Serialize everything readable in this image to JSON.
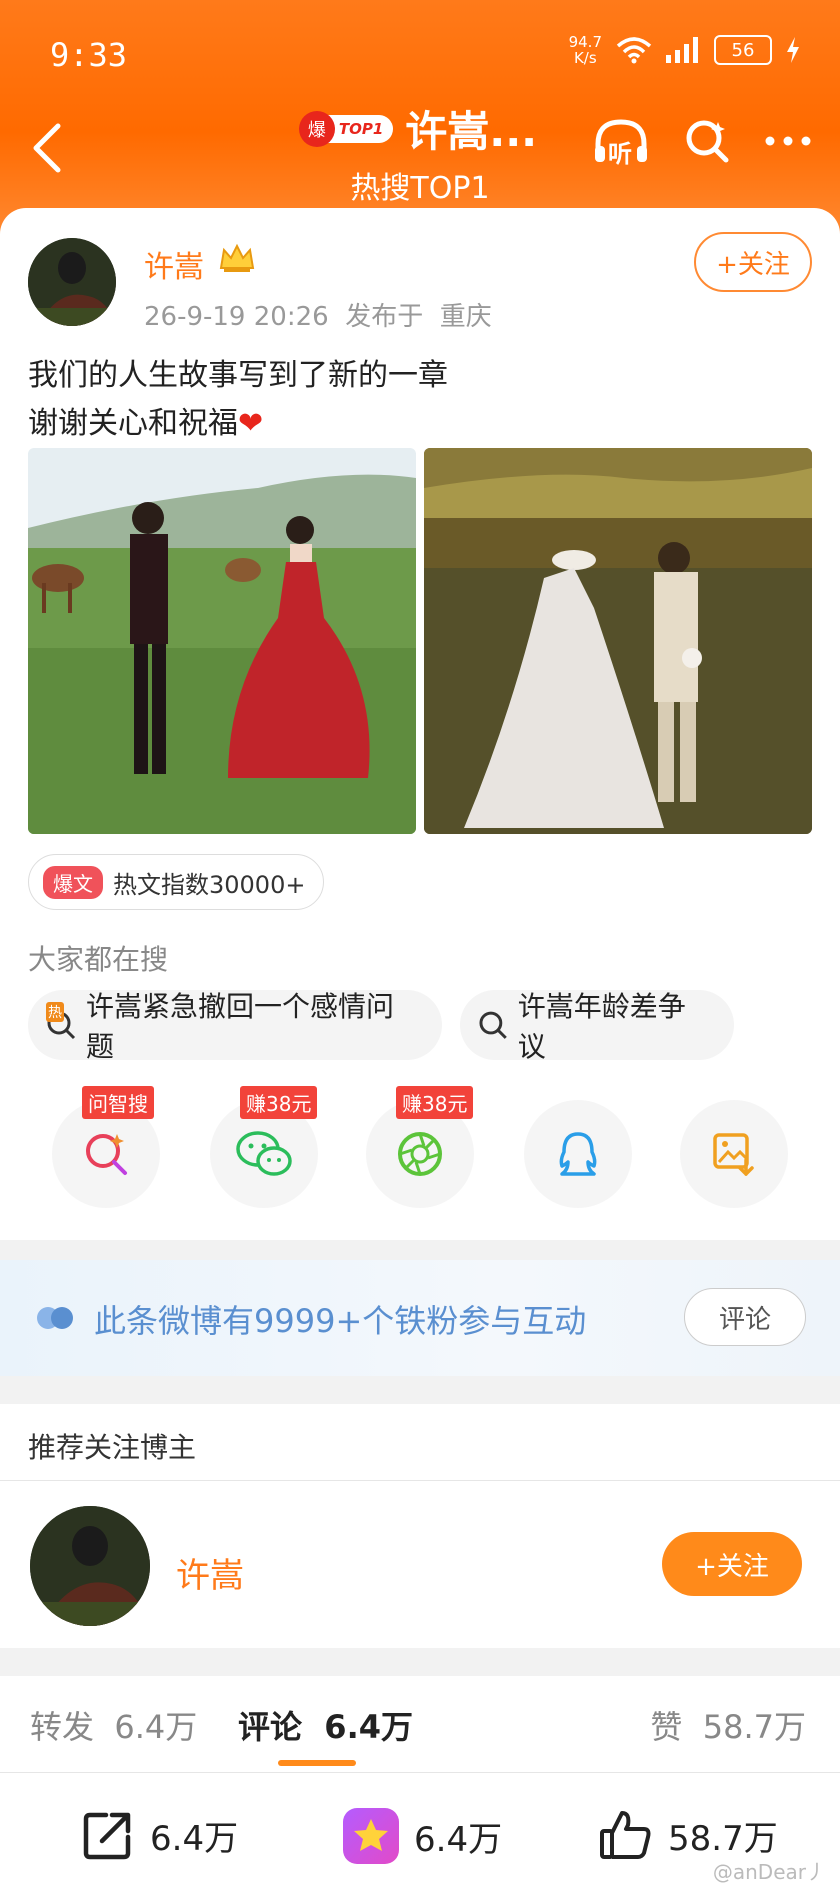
{
  "status_bar": {
    "time": "9:33",
    "speed_value": "94.7",
    "speed_unit": "K/s",
    "battery": "56"
  },
  "header": {
    "hot_badge_char": "爆",
    "hot_badge_label": "TOP1",
    "title": "许嵩...",
    "subtitle": "热搜TOP1",
    "listen_icon_text": "听"
  },
  "post": {
    "author": "许嵩",
    "date": "26-9-19 20:26",
    "location_prefix": "发布于",
    "location": "重庆",
    "follow_label": "+关注",
    "text_line1": "我们的人生故事写到了新的一章",
    "text_line2": "谢谢关心和祝福",
    "text_emoji": "❤",
    "hot_tag": "爆文",
    "hot_index": "热文指数30000+",
    "search_label": "大家都在搜",
    "search_chips": [
      {
        "label": "许嵩紧急撤回一个感情问题",
        "hot_badge": "热"
      },
      {
        "label": "许嵩年龄差争议"
      }
    ],
    "share_items": [
      {
        "name": "ai-search",
        "badge": "问智搜"
      },
      {
        "name": "wechat",
        "badge": "赚38元"
      },
      {
        "name": "moments",
        "badge": "赚38元"
      },
      {
        "name": "qq",
        "badge": ""
      },
      {
        "name": "save-image",
        "badge": ""
      }
    ]
  },
  "fans_banner": {
    "text": "此条微博有9999+个铁粉参与互动",
    "button": "评论"
  },
  "recommend": {
    "title": "推荐关注博主",
    "name": "许嵩",
    "follow_label": "+关注"
  },
  "tabs": {
    "repost_label": "转发",
    "repost_count": "6.4万",
    "comment_label": "评论",
    "comment_count": "6.4万",
    "like_label": "赞",
    "like_count": "58.7万"
  },
  "bottom_bar": {
    "share_count": "6.4万",
    "fav_count": "6.4万",
    "like_count": "58.7万"
  },
  "watermark": "@anDear丿",
  "colors": {
    "brand_orange": "#ff7a1a",
    "header_gradient": "#ff6a00",
    "fans_blue": "#5a8fd0",
    "hot_red": "#e8261c"
  }
}
